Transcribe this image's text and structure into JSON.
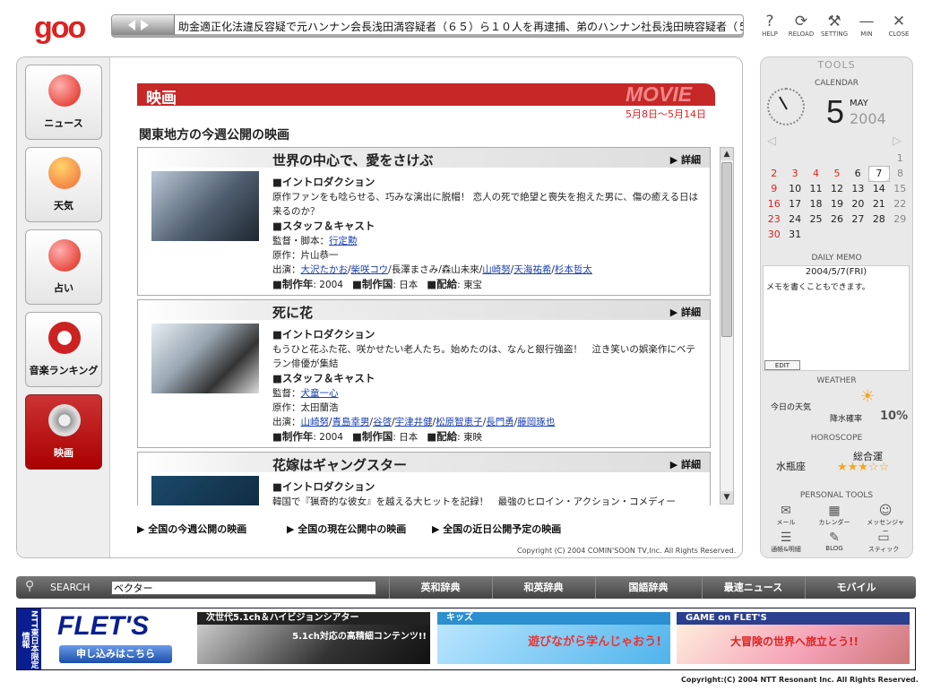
{
  "header": {
    "logo": "goo",
    "ticker": "助金適正化法違反容疑で元ハンナン会長浅田満容疑者（６５）ら１０人を再逮捕、弟のハンナン社長浅田暁容疑者（５",
    "buttons": [
      "HELP",
      "RELOAD",
      "SETTING",
      "MIN",
      "CLOSE"
    ],
    "button_glyphs": [
      "?",
      "⟳",
      "⚒",
      "—",
      "✕"
    ]
  },
  "nav": [
    {
      "label": "ニュース"
    },
    {
      "label": "天気"
    },
    {
      "label": "占い"
    },
    {
      "label": "音楽ランキング"
    },
    {
      "label": "映画"
    }
  ],
  "content": {
    "section_title": "映画",
    "section_en": "MOVIE",
    "date_range": "5月8日〜5月14日",
    "subheading": "関東地方の今週公開の映画",
    "detail_label": "▶ 詳細",
    "movies": [
      {
        "title": "世界の中心で、愛をさけぶ",
        "intro_h": "■イントロダクション",
        "intro": "原作ファンをも唸らせる、巧みな演出に脱帽！ 恋人の死で絶望と喪失を抱えた男に、傷の癒える日は来るのか？",
        "staff_h": "■スタッフ＆キャスト",
        "director_label": "監督・脚本：",
        "director": "行定勲",
        "original": "原作：片山恭一",
        "cast_label": "出演：",
        "cast": [
          "大沢たかお",
          "柴咲コウ",
          "長澤まさみ",
          "森山未來",
          "山崎努",
          "天海祐希",
          "杉本哲太"
        ],
        "year": "2004",
        "country": "日本",
        "distributor": "東宝"
      },
      {
        "title": "死に花",
        "intro_h": "■イントロダクション",
        "intro": "もうひと花ふた花、咲かせたい老人たち。始めたのは、なんと銀行強盗！　泣き笑いの娯楽作にベテラン俳優が集結",
        "staff_h": "■スタッフ＆キャスト",
        "director_label": "監督：",
        "director": "犬童一心",
        "original": "原作：太田蘭浩",
        "cast_label": "出演：",
        "cast": [
          "山崎努",
          "青島幸男",
          "谷啓",
          "宇津井健",
          "松原智恵子",
          "長門勇",
          "藤岡琢也"
        ],
        "year": "2004",
        "country": "日本",
        "distributor": "東映"
      },
      {
        "title": "花嫁はギャングスター",
        "intro_h": "■イントロダクション",
        "intro": "韓国で『猟奇的な彼女』を越える大ヒットを記録！　最強のヒロイン・アクション・コメディー"
      }
    ],
    "labels": {
      "year": "■制作年",
      "country": "■制作国",
      "distributor": "■配給"
    },
    "footer_links": [
      "▶ 全国の今週公開の映画",
      "▶ 全国の現在公開中の映画",
      "▶ 全国の近日公開予定の映画"
    ],
    "copyright": "Copyright (C) 2004 COMIN'SOON TV,Inc. All Rights Reserved."
  },
  "tools": {
    "title": "TOOLS",
    "calendar_title": "CALENDAR",
    "day": "5",
    "month": "MAY",
    "year": "2004",
    "calendar_rows": [
      [
        "",
        "",
        "",
        "",
        "",
        "",
        "1"
      ],
      [
        "2",
        "3",
        "4",
        "5",
        "6",
        "7",
        "8"
      ],
      [
        "9",
        "10",
        "11",
        "12",
        "13",
        "14",
        "15"
      ],
      [
        "16",
        "17",
        "18",
        "19",
        "20",
        "21",
        "22"
      ],
      [
        "23",
        "24",
        "25",
        "26",
        "27",
        "28",
        "29"
      ],
      [
        "30",
        "31",
        "",
        "",
        "",
        "",
        ""
      ]
    ],
    "memo_title": "DAILY MEMO",
    "memo_date": "2004/5/7(FRI)",
    "memo_text": "メモを書くこともできます。",
    "edit_label": "EDIT",
    "weather_title": "WEATHER",
    "weather_label": "今日の天気",
    "rain_label": "降水確率",
    "rain_value": "10%",
    "horoscope_title": "HOROSCOPE",
    "sign": "水瓶座",
    "fortune_label": "総合運",
    "stars": "★★★☆☆",
    "personal_title": "PERSONAL TOOLS",
    "personal": [
      {
        "label": "メール",
        "glyph": "✉"
      },
      {
        "label": "カレンダー",
        "glyph": "▦"
      },
      {
        "label": "メッセンジャー",
        "glyph": "☺"
      },
      {
        "label": "通帳&明細",
        "glyph": "☰"
      },
      {
        "label": "BLOG",
        "glyph": "✎"
      },
      {
        "label": "スティック",
        "glyph": "▭"
      }
    ]
  },
  "search": {
    "label": "SEARCH",
    "value": "ベクター",
    "buttons": [
      "英和辞典",
      "和英辞典",
      "国語辞典",
      "最速ニュース",
      "モバイル"
    ]
  },
  "ads": {
    "side": "NTT東日本限定情報",
    "flets": "FLET'S",
    "flets_btn": "申し込みはこちら",
    "banners": [
      {
        "title": "次世代5.1ch＆ハイビジョンシアター",
        "sub": "5.1ch対応の高精細コンテンツ!!"
      },
      {
        "title": "キッズ",
        "sub": "遊びながら学んじゃおう!"
      },
      {
        "title": "GAME on FLET'S",
        "sub": "大冒険の世界へ旅立とう!!"
      }
    ]
  },
  "footer_copyright": "Copyright:(C) 2004 NTT Resonant Inc. All Rights Reserved.",
  "colors": {
    "accent": "#c62828",
    "nav_active": "#b01010",
    "ad_blue": "#0a1f8f"
  }
}
